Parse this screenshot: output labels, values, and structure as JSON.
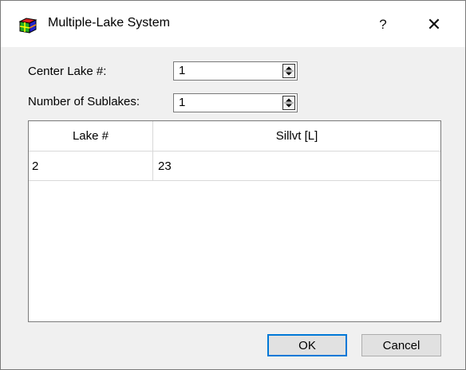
{
  "window": {
    "title": "Multiple-Lake System",
    "help_glyph": "?",
    "close_glyph": "✕"
  },
  "form": {
    "center_lake_label": "Center Lake #:",
    "center_lake_value": "1",
    "sublakes_label": "Number of Sublakes:",
    "sublakes_value": "1"
  },
  "table": {
    "columns": [
      "Lake #",
      "Sillvt [L]"
    ],
    "rows": [
      [
        "2",
        "23"
      ]
    ]
  },
  "buttons": {
    "ok": "OK",
    "cancel": "Cancel"
  },
  "colors": {
    "focus_border": "#0078d7",
    "window_bg": "#f0f0f0"
  }
}
